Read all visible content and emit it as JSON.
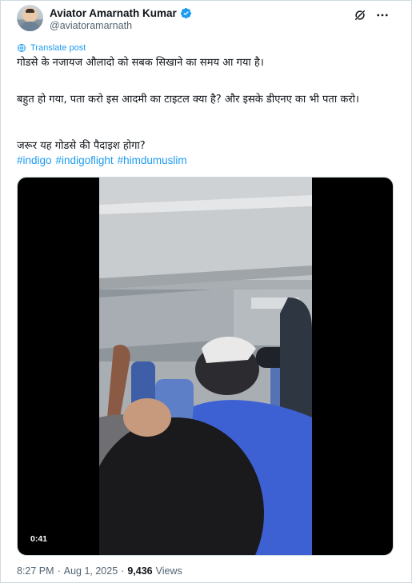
{
  "author": {
    "display_name": "Aviator Amarnath Kumar",
    "handle": "@aviatoramarnath",
    "verified_color": "#1d9bf0"
  },
  "actions": {
    "grok_icon": "grok-icon",
    "more_icon": "more-icon"
  },
  "translate": {
    "label": "Translate post"
  },
  "post": {
    "line1": "गोडसे के नजायज औलादो को सबक सिखाने का समय आ गया है।",
    "line2": "बहुत हो गया, पता करो इस आदमी का टाइटल क्या है? और इसके डीएनए का भी पता करो।",
    "line3": "जरूर यह गोडसे की पैदाइश होगा?",
    "hashtags": [
      "#indigo",
      "#indigoflight",
      "#himdumuslim"
    ]
  },
  "media": {
    "type": "video",
    "duration": "0:41"
  },
  "meta": {
    "time": "8:27 PM",
    "separator": "·",
    "date": "Aug 1, 2025",
    "views_count": "9,436",
    "views_label": "Views"
  },
  "colors": {
    "link": "#1d9bf0",
    "text": "#0f1419",
    "secondary": "#536471",
    "border": "#cfd9de"
  }
}
